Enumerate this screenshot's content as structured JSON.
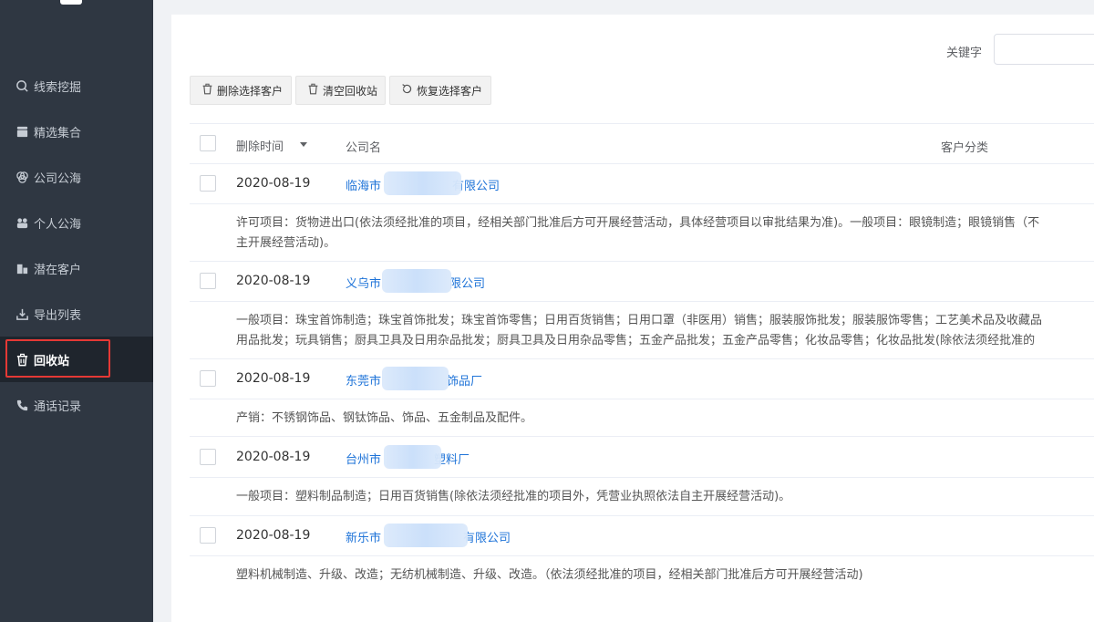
{
  "sidebar": {
    "items": [
      {
        "label": "线索挖掘",
        "icon": "search-icon"
      },
      {
        "label": "精选集合",
        "icon": "collection-icon"
      },
      {
        "label": "公司公海",
        "icon": "company-pool-icon"
      },
      {
        "label": "个人公海",
        "icon": "personal-pool-icon"
      },
      {
        "label": "潜在客户",
        "icon": "building-icon"
      },
      {
        "label": "导出列表",
        "icon": "export-icon"
      },
      {
        "label": "回收站",
        "icon": "trash-icon"
      },
      {
        "label": "通话记录",
        "icon": "phone-icon"
      }
    ],
    "active_index": 6,
    "active_highlight_color": "#e53935"
  },
  "search": {
    "label": "关键字",
    "value": ""
  },
  "toolbar": {
    "delete_label": "删除选择客户",
    "clear_label": "清空回收站",
    "restore_label": "恢复选择客户"
  },
  "table": {
    "headers": {
      "time": "删除时间",
      "company": "公司名",
      "category": "客户分类"
    },
    "rows": [
      {
        "date": "2020-08-19",
        "company_prefix": "临海市",
        "company_suffix": "有限公司",
        "desc_line1": "许可项目：货物进出口(依法须经批准的项目，经相关部门批准后方可开展经营活动，具体经营项目以审批结果为准)。一般项目：眼镜制造；眼镜销售（不",
        "desc_line2": "主开展经营活动)。"
      },
      {
        "date": "2020-08-19",
        "company_prefix": "义乌市",
        "company_suffix": "限公司",
        "desc_line1": "一般项目：珠宝首饰制造；珠宝首饰批发；珠宝首饰零售；日用百货销售；日用口罩（非医用）销售；服装服饰批发；服装服饰零售；工艺美术品及收藏品",
        "desc_line2": "用品批发；玩具销售；厨具卫具及日用杂品批发；厨具卫具及日用杂品零售；五金产品批发；五金产品零售；化妆品零售；化妆品批发(除依法须经批准的"
      },
      {
        "date": "2020-08-19",
        "company_prefix": "东莞市",
        "company_suffix": "饰品厂",
        "desc_line1": "产销：不锈钢饰品、钢钛饰品、饰品、五金制品及配件。",
        "desc_line2": ""
      },
      {
        "date": "2020-08-19",
        "company_prefix": "台州市",
        "company_suffix": "塑料厂",
        "desc_line1": "一般项目：塑料制品制造；日用百货销售(除依法须经批准的项目外，凭营业执照依法自主开展经营活动)。",
        "desc_line2": ""
      },
      {
        "date": "2020-08-19",
        "company_prefix": "新乐市",
        "company_suffix": "有限公司",
        "desc_line1": "塑料机械制造、升级、改造；无纺机械制造、升级、改造。（依法须经批准的项目，经相关部门批准后方可开展经营活动)",
        "desc_line2": ""
      }
    ]
  },
  "colors": {
    "link": "#1e73d8",
    "sidebar_bg": "#2f3742",
    "sidebar_active_bg": "#1f252d"
  }
}
